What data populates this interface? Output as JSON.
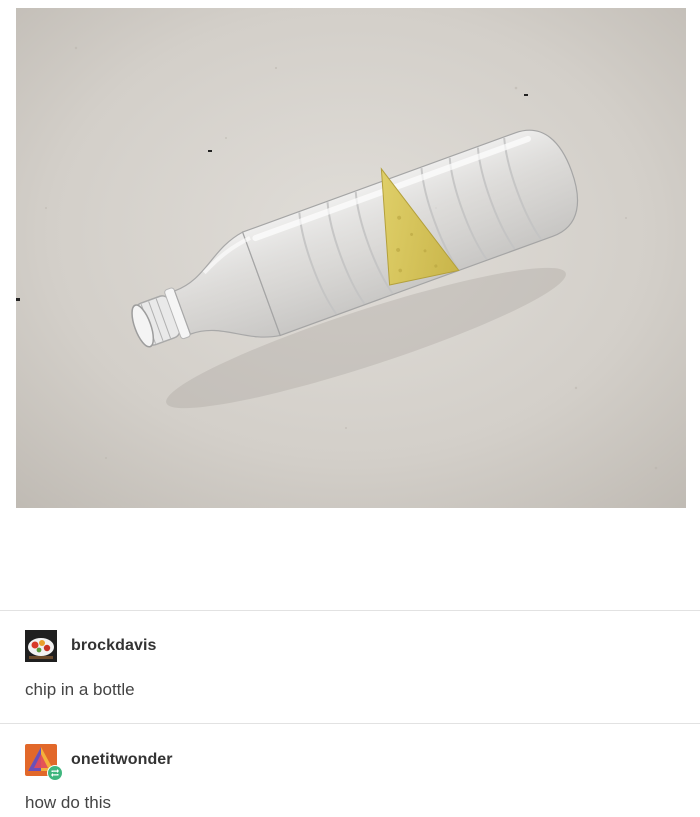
{
  "post_image": {
    "subject": "chip-in-bottle-photo"
  },
  "posts": [
    {
      "username": "brockdavis",
      "text": "chip in a bottle",
      "avatar_icon": "food-plate-avatar-icon"
    },
    {
      "username": "onetitwonder",
      "text": "how do this",
      "avatar_icon": "triangle-avatar-icon",
      "reblog_badge_icon": "reblog-icon"
    }
  ],
  "colors": {
    "background": "#ffffff",
    "concrete": "#d6d2cc",
    "chip": "#d8c85a",
    "reblog_badge": "#3fb67e",
    "avatar_orange": "#e2682a"
  }
}
